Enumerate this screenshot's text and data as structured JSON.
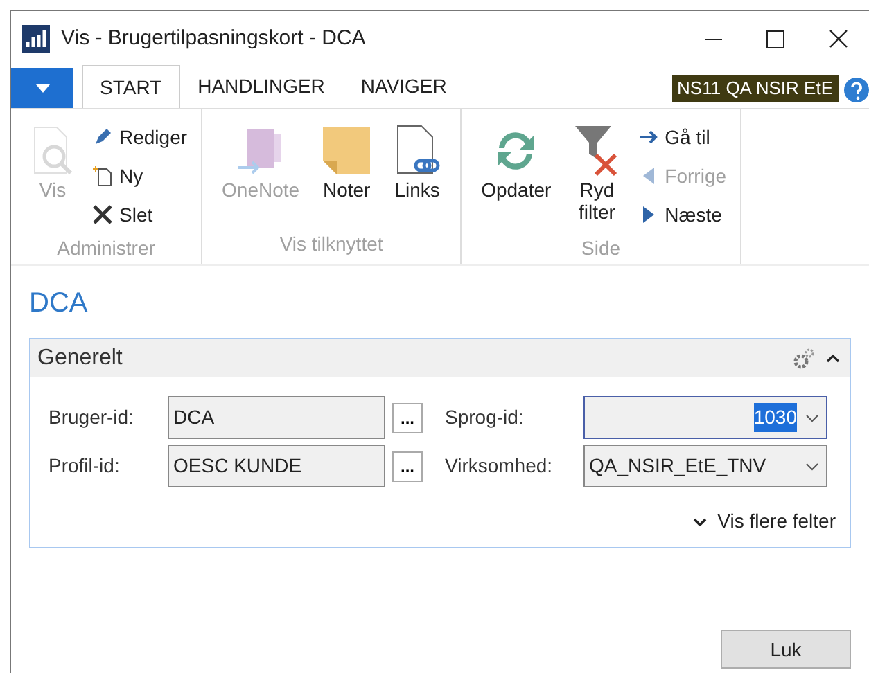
{
  "window": {
    "title": "Vis - Brugertilpasningskort - DCA"
  },
  "tabs": [
    {
      "label": "START",
      "selected": true
    },
    {
      "label": "HANDLINGER",
      "selected": false
    },
    {
      "label": "NAVIGER",
      "selected": false
    }
  ],
  "company_badge": "NS11 QA NSIR EtE",
  "ribbon_groups": [
    {
      "label": "Administrer",
      "actions": [
        {
          "kind": "large",
          "label": "Vis",
          "disabled": true
        },
        {
          "kind": "small",
          "label": "Rediger",
          "disabled": false
        },
        {
          "kind": "small",
          "label": "Ny",
          "disabled": false
        },
        {
          "kind": "small",
          "label": "Slet",
          "disabled": false
        }
      ]
    },
    {
      "label": "Vis tilknyttet",
      "actions": [
        {
          "kind": "large",
          "label": "OneNote",
          "disabled": true
        },
        {
          "kind": "large",
          "label": "Noter",
          "disabled": false
        },
        {
          "kind": "large",
          "label": "Links",
          "disabled": false
        }
      ]
    },
    {
      "label": "Side",
      "actions": [
        {
          "kind": "large",
          "label": "Opdater",
          "disabled": false
        },
        {
          "kind": "large",
          "label": "Ryd filter",
          "disabled": false
        },
        {
          "kind": "small",
          "label": "Gå til",
          "disabled": false
        },
        {
          "kind": "small",
          "label": "Forrige",
          "disabled": true
        },
        {
          "kind": "small",
          "label": "Næste",
          "disabled": false
        }
      ]
    }
  ],
  "page_title": "DCA",
  "section": {
    "title": "Generelt",
    "expanded": true,
    "fields": [
      {
        "label": "Bruger-id:",
        "value": "DCA",
        "kind": "lookup",
        "lookup_button": "...",
        "focused": false
      },
      {
        "label": "Sprog-id:",
        "value": "1030",
        "kind": "dropdown",
        "focused": true
      },
      {
        "label": "Profil-id:",
        "value": "OESC KUNDE",
        "kind": "lookup",
        "lookup_button": "...",
        "focused": false
      },
      {
        "label": "Virksomhed:",
        "value": "QA_NSIR_EtE_TNV",
        "kind": "dropdown",
        "focused": false
      }
    ],
    "more_fields": "Vis flere felter"
  },
  "buttons": [
    "Luk"
  ]
}
